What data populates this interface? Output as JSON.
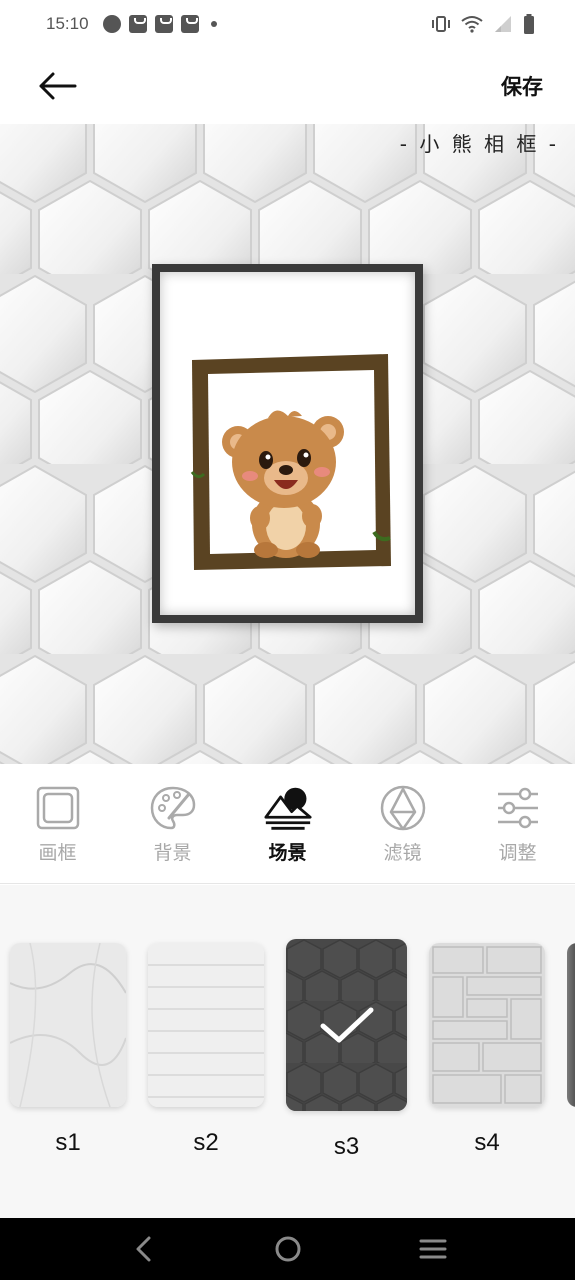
{
  "status_bar": {
    "time": "15:10",
    "left_icons": [
      "speedometer-icon",
      "bag-icon",
      "bag-icon",
      "bag-icon",
      "dot-icon"
    ],
    "right_icons": [
      "vibrate-icon",
      "wifi-icon",
      "signal-icon",
      "battery-icon"
    ]
  },
  "app_bar": {
    "back_icon": "arrow-left-icon",
    "save_label": "保存"
  },
  "preview": {
    "frame_title": "- 小 熊 相 框 -"
  },
  "tool_tabs": [
    {
      "label": "画框",
      "icon": "frame-icon",
      "active": false
    },
    {
      "label": "背景",
      "icon": "palette-icon",
      "active": false
    },
    {
      "label": "场景",
      "icon": "mountain-sun-icon",
      "active": true
    },
    {
      "label": "滤镜",
      "icon": "filter-circles-icon",
      "active": false
    },
    {
      "label": "调整",
      "icon": "sliders-icon",
      "active": false
    }
  ],
  "scenes": [
    {
      "label": "s1",
      "texture": "marble",
      "selected": false
    },
    {
      "label": "s2",
      "texture": "wood-planks",
      "selected": false
    },
    {
      "label": "s3",
      "texture": "dark-hexagon",
      "selected": true
    },
    {
      "label": "s4",
      "texture": "stone-wall",
      "selected": false
    }
  ],
  "nav_bar": {
    "icons": [
      "nav-back-icon",
      "nav-home-icon",
      "nav-menu-icon"
    ]
  },
  "colors": {
    "active_tab": "#111111",
    "inactive_tab": "#a8a8a8",
    "frame_dark": "#3a3a3a",
    "wood_frame": "#5a4322",
    "bear_fur": "#c98a4b"
  }
}
